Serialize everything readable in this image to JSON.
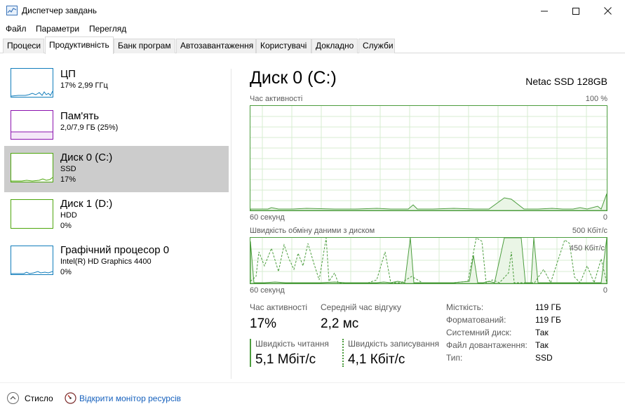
{
  "window": {
    "title": "Диспетчер завдань",
    "controls": {
      "minimize": "—",
      "maximize": "☐",
      "close": "✕"
    },
    "app_icon": "task-manager-icon"
  },
  "menu": [
    "Файл",
    "Параметри",
    "Перегляд"
  ],
  "tabs": [
    "Процеси",
    "Продуктивність",
    "Банк програм",
    "Автозавантаження",
    "Користувачі",
    "Докладно",
    "Служби"
  ],
  "active_tab": "Продуктивність",
  "sidebar": [
    {
      "name": "ЦП",
      "line1": "17% 2,99 ГГц",
      "line2": "",
      "color": "#117dbb"
    },
    {
      "name": "Пам'ять",
      "line1": "2,0/7,9 ГБ (25%)",
      "line2": "",
      "color": "#8b12ae",
      "fill_fraction": 0.25
    },
    {
      "name": "Диск 0 (C:)",
      "line1": "SSD",
      "line2": "17%",
      "color": "#4da60c",
      "selected": true
    },
    {
      "name": "Диск 1 (D:)",
      "line1": "HDD",
      "line2": "0%",
      "color": "#4da60c"
    },
    {
      "name": "Графічний процесор 0",
      "line1": "Intel(R) HD Graphics 4400",
      "line2": "0%",
      "color": "#117dbb"
    }
  ],
  "main": {
    "title": "Диск 0 (C:)",
    "model": "Netac SSD 128GB",
    "graph1": {
      "label": "Час активності",
      "max_label": "100 %",
      "time_label": "60 секунд",
      "zero_label": "0"
    },
    "graph2": {
      "label": "Швидкість обміну даними з диском",
      "max_label": "500 Кбіт/с",
      "secondary_label": "450 Кбіт/с",
      "time_label": "60 секунд",
      "zero_label": "0"
    },
    "stats": {
      "active_time_label": "Час активності",
      "active_time_value": "17%",
      "avg_response_label": "Середній час відгуку",
      "avg_response_value": "2,2 мс",
      "read_speed_label": "Швидкість читання",
      "read_speed_value": "5,1 Мбіт/с",
      "write_speed_label": "Швидкість записування",
      "write_speed_value": "4,1 Кбіт/с"
    },
    "info": [
      {
        "key": "Місткість:",
        "value": "119 ГБ"
      },
      {
        "key": "Форматований:",
        "value": "119 ГБ"
      },
      {
        "key": "Системний диск:",
        "value": "Так"
      },
      {
        "key": "Файл довантаження:",
        "value": "Так"
      },
      {
        "key": "Тип:",
        "value": "SSD"
      }
    ]
  },
  "footer": {
    "fewer_details": "Стисло",
    "open_resmon": "Відкрити монітор ресурсів"
  },
  "colors": {
    "disk_green": "#4c9d3e",
    "link_blue": "#1560bd",
    "selected_bg": "#cccccc"
  }
}
